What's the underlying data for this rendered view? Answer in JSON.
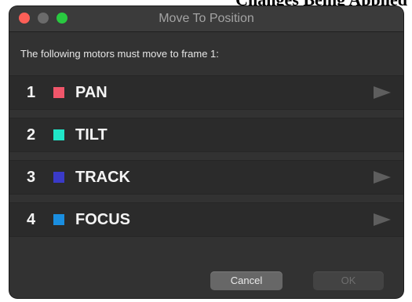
{
  "page_header": {
    "fragment": "Changes Being Applied"
  },
  "window": {
    "title": "Move To Position",
    "message": "The following motors must move to frame 1:"
  },
  "motors": [
    {
      "number": "1",
      "name": "PAN",
      "color": "#f0566a",
      "has_move_button": true
    },
    {
      "number": "2",
      "name": "TILT",
      "color": "#20e6c8",
      "has_move_button": false
    },
    {
      "number": "3",
      "name": "TRACK",
      "color": "#3a3ac8",
      "has_move_button": true
    },
    {
      "number": "4",
      "name": "FOCUS",
      "color": "#1a8ee0",
      "has_move_button": true
    }
  ],
  "buttons": {
    "cancel": "Cancel",
    "ok": "OK"
  },
  "icons": {
    "move_button": "play-triangle-icon"
  }
}
